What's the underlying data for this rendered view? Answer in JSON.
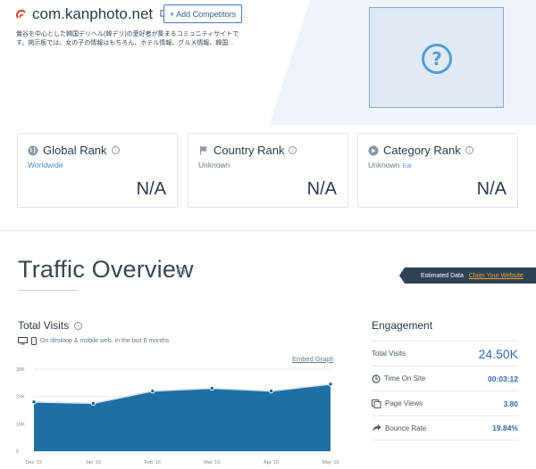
{
  "site": {
    "title": "com.kanphoto.net",
    "description": "鶯谷を中心とした韓国デリヘル(韓デリ)の愛好者が集まるコミュニティサイトです。掲示板では、女の子の情報はもちろん、ホテル情報、グルメ情報、韓国…",
    "add_competitors_label": "+ Add Competitors",
    "thumbnail_icon": "question-icon"
  },
  "ranks": [
    {
      "title": "Global Rank",
      "sub": "Worldwide",
      "value": "N/A",
      "icon": "globe-icon"
    },
    {
      "title": "Country Rank",
      "sub": "Unknown",
      "value": "N/A",
      "icon": "flag-icon"
    },
    {
      "title": "Category Rank",
      "sub": "Unknown",
      "edit": "Edit",
      "value": "N/A",
      "icon": "category-icon"
    }
  ],
  "traffic": {
    "title": "Traffic Overview",
    "estimated_label": "Estimated Data",
    "claim_label": "Claim Your Website"
  },
  "total_visits": {
    "title": "Total Visits",
    "subtitle": "On desktop & mobile web, in the last 6 months",
    "embed_label": "Embed Graph"
  },
  "engagement": {
    "title": "Engagement",
    "rows": [
      {
        "label": "Total Visits",
        "value": "24.50K",
        "icon": ""
      },
      {
        "label": "Time On Site",
        "value": "00:03:12",
        "icon": "clock-icon"
      },
      {
        "label": "Page Views",
        "value": "3.80",
        "icon": "pages-icon"
      },
      {
        "label": "Bounce Rate",
        "value": "19.84%",
        "icon": "bounce-icon"
      }
    ]
  },
  "colors": {
    "accent": "#2c6aa6",
    "area_fill": "#1f6fa4",
    "estimated_bg": "#2f4256",
    "claim": "#f4a230"
  },
  "chart_data": {
    "type": "area",
    "categories": [
      "Dec '15",
      "Jan '16",
      "Feb '16",
      "Mar '16",
      "Apr '16",
      "May '16"
    ],
    "values": [
      18000,
      17500,
      22000,
      23000,
      22000,
      24500
    ],
    "yticks": [
      "0",
      "10K",
      "20K",
      "30K"
    ],
    "ylim": [
      0,
      30000
    ],
    "grid": true
  }
}
